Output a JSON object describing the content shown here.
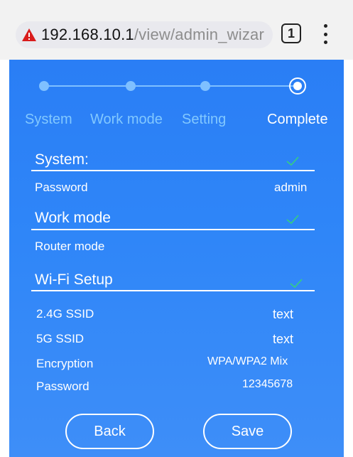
{
  "browser": {
    "url_host": "192.168.10.1",
    "url_path": "/view/admin_wizar",
    "tab_count": "1",
    "warning_color": "#d91c1c"
  },
  "wizard": {
    "steps": [
      {
        "label": "System",
        "state": "done"
      },
      {
        "label": "Work mode",
        "state": "done"
      },
      {
        "label": "Setting",
        "state": "done"
      },
      {
        "label": "Complete",
        "state": "current"
      }
    ]
  },
  "summary": {
    "system": {
      "title": "System:",
      "rows": [
        {
          "label": "Password",
          "value": "admin"
        }
      ]
    },
    "work_mode": {
      "title": "Work mode",
      "rows": [
        {
          "label": "Router mode",
          "value": ""
        }
      ]
    },
    "wifi": {
      "title": "Wi-Fi Setup",
      "rows": [
        {
          "label": "2.4G SSID",
          "value": "text"
        },
        {
          "label": "5G SSID",
          "value": "text"
        },
        {
          "label": "Encryption",
          "value": "WPA/WPA2 Mix"
        },
        {
          "label": "Password",
          "value": "12345678"
        }
      ]
    }
  },
  "actions": {
    "back_label": "Back",
    "save_label": "Save"
  },
  "colors": {
    "panel_blue": "#2f86f8",
    "inactive_step": "#82c8ff",
    "check_green": "#35d07f"
  }
}
